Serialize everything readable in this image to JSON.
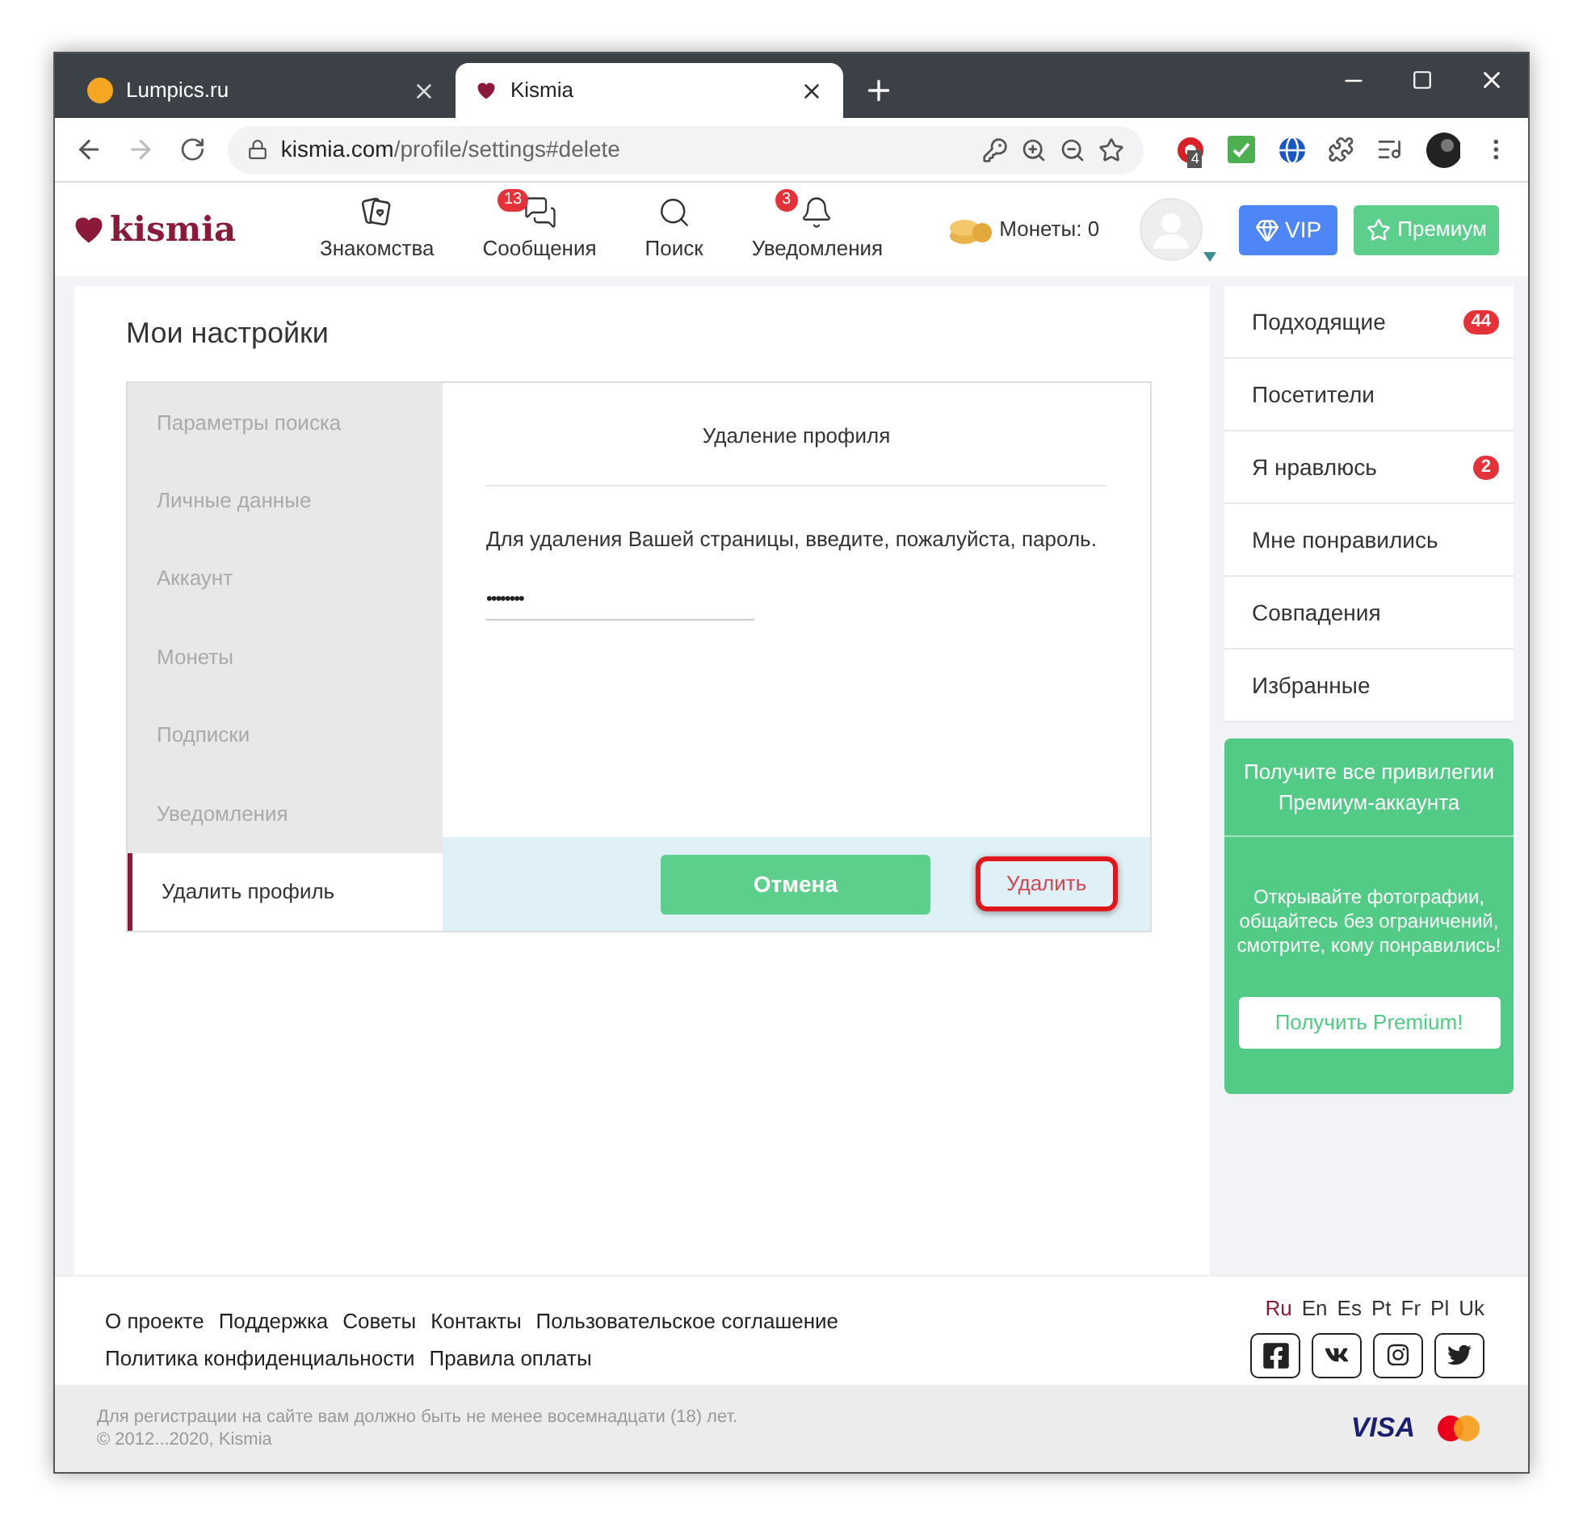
{
  "browser": {
    "tabs": [
      {
        "title": "Lumpics.ru",
        "selected": false,
        "kind": "orange"
      },
      {
        "title": "Kismia",
        "selected": true,
        "kind": "heart"
      }
    ],
    "url": {
      "domain": "kismia.com",
      "path": "/profile/settings#delete"
    },
    "extension_badge": "4"
  },
  "header": {
    "logo": "kismia",
    "nav": [
      {
        "label": "Знакомства",
        "kind": "cards"
      },
      {
        "label": "Сообщения",
        "kind": "chat",
        "badge": "13"
      },
      {
        "label": "Поиск",
        "kind": "search"
      },
      {
        "label": "Уведомления",
        "kind": "bell",
        "badge": "3"
      }
    ],
    "coins": "Монеты: 0",
    "vip": "VIP",
    "premium": "Премиум"
  },
  "settings": {
    "title": "Мои настройки",
    "menu": [
      {
        "label": "Параметры поиска",
        "selected": false
      },
      {
        "label": "Личные данные",
        "selected": false
      },
      {
        "label": "Аккаунт",
        "selected": false
      },
      {
        "label": "Монеты",
        "selected": false
      },
      {
        "label": "Подписки",
        "selected": false
      },
      {
        "label": "Уведомления",
        "selected": false
      },
      {
        "label": "Удалить профиль",
        "selected": true
      }
    ],
    "panel": {
      "heading": "Удаление профиля",
      "instruction": "Для удаления Вашей страницы, введите, пожалуйста, пароль.",
      "password": "••••••••",
      "cancel": "Отмена",
      "delete": "Удалить",
      "delete_highlighted": true
    }
  },
  "sidebar": {
    "items": [
      {
        "label": "Подходящие",
        "badge": "44"
      },
      {
        "label": "Посетители"
      },
      {
        "label": "Я нравлюсь",
        "badge": "2"
      },
      {
        "label": "Мне понравились"
      },
      {
        "label": "Совпадения"
      },
      {
        "label": "Избранные"
      }
    ],
    "promo": {
      "title": "Получите все привилегии Премиум-аккаунта",
      "text": "Открывайте фотографии, общайтесь без ограничений, смотрите, кому понравились!",
      "button": "Получить Premium!"
    }
  },
  "footer": {
    "links": [
      [
        "О проекте",
        "Поддержка",
        "Советы",
        "Контакты",
        "Пользовательское соглашение"
      ],
      [
        "Политика конфиденциальности",
        "Правила оплаты"
      ]
    ],
    "languages": [
      {
        "label": "Ru",
        "selected": true
      },
      {
        "label": "En",
        "selected": false
      },
      {
        "label": "Es",
        "selected": false
      },
      {
        "label": "Pt",
        "selected": false
      },
      {
        "label": "Fr",
        "selected": false
      },
      {
        "label": "Pl",
        "selected": false
      },
      {
        "label": "Uk",
        "selected": false
      }
    ],
    "social": [
      {
        "kind": "facebook"
      },
      {
        "kind": "vk"
      },
      {
        "kind": "instagram"
      },
      {
        "kind": "twitter"
      }
    ],
    "disclaimer": "Для регистрации на сайте вам должно быть не менее восемнадцати (18) лет.",
    "copyright": "© 2012...2020, Kismia",
    "card": "VISA"
  }
}
